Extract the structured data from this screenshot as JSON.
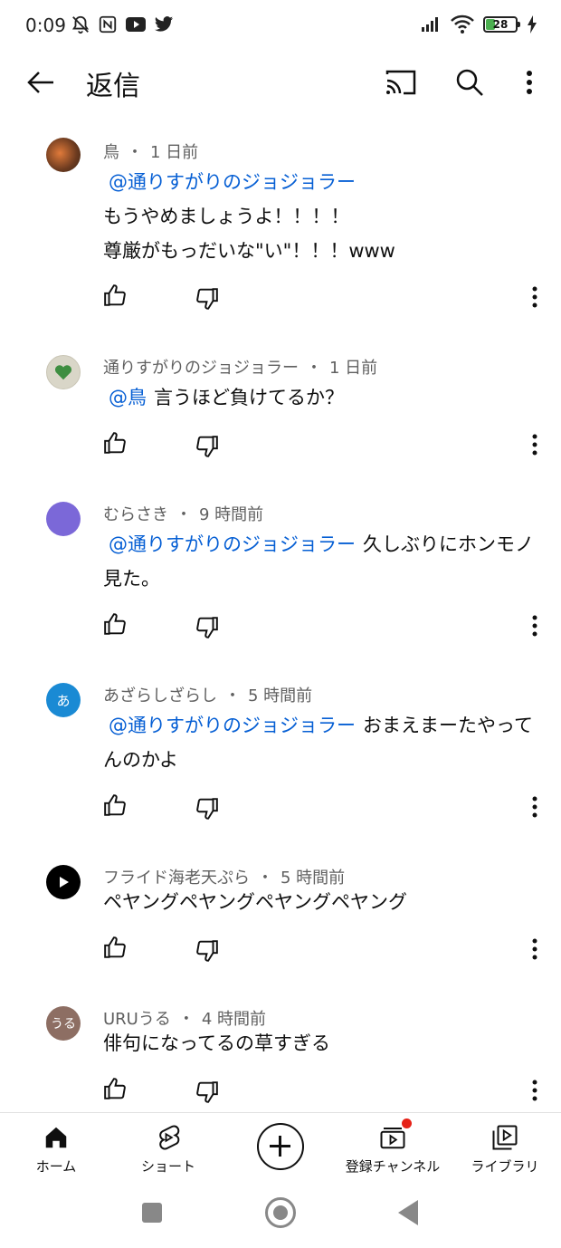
{
  "status_bar": {
    "time": "0:09",
    "battery": "28"
  },
  "app_bar": {
    "title": "返信",
    "icons": [
      "back-arrow-icon",
      "cast-icon",
      "search-icon",
      "more-vert-icon"
    ]
  },
  "comments": [
    {
      "author": "鳥",
      "time": "1 日前",
      "mention": "@通りすがりのジョジョラー",
      "lines": [
        "もうやめましょうよ！！！！",
        "尊厳がもっだいな\"い\"！！！www"
      ],
      "avatar_color": "#8a5a3a"
    },
    {
      "author": "通りすがりのジョジョラー",
      "time": "1 日前",
      "mention": "@鳥",
      "text": "言うほど負けてるか？",
      "avatar_color": "#d9d6c8"
    },
    {
      "author": "むらさき",
      "time": "9 時間前",
      "mention": "@通りすがりのジョジョラー",
      "text": "久しぶりにホンモノ見た。",
      "avatar_color": "#7b68d8"
    },
    {
      "author": "あざらしざらし",
      "time": "5 時間前",
      "mention": "@通りすがりのジョジョラー",
      "text": "おまえまーたやってんのかよ",
      "avatar_letter": "あ",
      "avatar_color": "#1a8ad4"
    },
    {
      "author": "フライド海老天ぷら",
      "time": "5 時間前",
      "text": "ペヤングペヤングペヤングペヤング",
      "avatar_color": "#000000"
    },
    {
      "author": "URUうる",
      "time": "4 時間前",
      "text": "俳句になってるの草すぎる",
      "avatar_letter": "うる",
      "avatar_color": "#8d6e63"
    }
  ],
  "bottom_nav": {
    "home": "ホーム",
    "shorts": "ショート",
    "subscriptions": "登録チャンネル",
    "library": "ライブラリ"
  },
  "colors": {
    "mention": "#065fd4",
    "notification_dot": "#e62117"
  }
}
